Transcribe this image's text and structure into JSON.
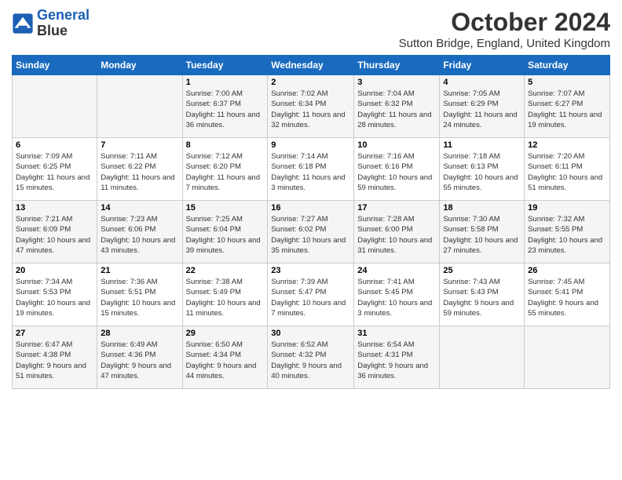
{
  "logo": {
    "line1": "General",
    "line2": "Blue"
  },
  "title": "October 2024",
  "location": "Sutton Bridge, England, United Kingdom",
  "headers": [
    "Sunday",
    "Monday",
    "Tuesday",
    "Wednesday",
    "Thursday",
    "Friday",
    "Saturday"
  ],
  "weeks": [
    [
      {
        "day": "",
        "sunrise": "",
        "sunset": "",
        "daylight": ""
      },
      {
        "day": "",
        "sunrise": "",
        "sunset": "",
        "daylight": ""
      },
      {
        "day": "1",
        "sunrise": "Sunrise: 7:00 AM",
        "sunset": "Sunset: 6:37 PM",
        "daylight": "Daylight: 11 hours and 36 minutes."
      },
      {
        "day": "2",
        "sunrise": "Sunrise: 7:02 AM",
        "sunset": "Sunset: 6:34 PM",
        "daylight": "Daylight: 11 hours and 32 minutes."
      },
      {
        "day": "3",
        "sunrise": "Sunrise: 7:04 AM",
        "sunset": "Sunset: 6:32 PM",
        "daylight": "Daylight: 11 hours and 28 minutes."
      },
      {
        "day": "4",
        "sunrise": "Sunrise: 7:05 AM",
        "sunset": "Sunset: 6:29 PM",
        "daylight": "Daylight: 11 hours and 24 minutes."
      },
      {
        "day": "5",
        "sunrise": "Sunrise: 7:07 AM",
        "sunset": "Sunset: 6:27 PM",
        "daylight": "Daylight: 11 hours and 19 minutes."
      }
    ],
    [
      {
        "day": "6",
        "sunrise": "Sunrise: 7:09 AM",
        "sunset": "Sunset: 6:25 PM",
        "daylight": "Daylight: 11 hours and 15 minutes."
      },
      {
        "day": "7",
        "sunrise": "Sunrise: 7:11 AM",
        "sunset": "Sunset: 6:22 PM",
        "daylight": "Daylight: 11 hours and 11 minutes."
      },
      {
        "day": "8",
        "sunrise": "Sunrise: 7:12 AM",
        "sunset": "Sunset: 6:20 PM",
        "daylight": "Daylight: 11 hours and 7 minutes."
      },
      {
        "day": "9",
        "sunrise": "Sunrise: 7:14 AM",
        "sunset": "Sunset: 6:18 PM",
        "daylight": "Daylight: 11 hours and 3 minutes."
      },
      {
        "day": "10",
        "sunrise": "Sunrise: 7:16 AM",
        "sunset": "Sunset: 6:16 PM",
        "daylight": "Daylight: 10 hours and 59 minutes."
      },
      {
        "day": "11",
        "sunrise": "Sunrise: 7:18 AM",
        "sunset": "Sunset: 6:13 PM",
        "daylight": "Daylight: 10 hours and 55 minutes."
      },
      {
        "day": "12",
        "sunrise": "Sunrise: 7:20 AM",
        "sunset": "Sunset: 6:11 PM",
        "daylight": "Daylight: 10 hours and 51 minutes."
      }
    ],
    [
      {
        "day": "13",
        "sunrise": "Sunrise: 7:21 AM",
        "sunset": "Sunset: 6:09 PM",
        "daylight": "Daylight: 10 hours and 47 minutes."
      },
      {
        "day": "14",
        "sunrise": "Sunrise: 7:23 AM",
        "sunset": "Sunset: 6:06 PM",
        "daylight": "Daylight: 10 hours and 43 minutes."
      },
      {
        "day": "15",
        "sunrise": "Sunrise: 7:25 AM",
        "sunset": "Sunset: 6:04 PM",
        "daylight": "Daylight: 10 hours and 39 minutes."
      },
      {
        "day": "16",
        "sunrise": "Sunrise: 7:27 AM",
        "sunset": "Sunset: 6:02 PM",
        "daylight": "Daylight: 10 hours and 35 minutes."
      },
      {
        "day": "17",
        "sunrise": "Sunrise: 7:28 AM",
        "sunset": "Sunset: 6:00 PM",
        "daylight": "Daylight: 10 hours and 31 minutes."
      },
      {
        "day": "18",
        "sunrise": "Sunrise: 7:30 AM",
        "sunset": "Sunset: 5:58 PM",
        "daylight": "Daylight: 10 hours and 27 minutes."
      },
      {
        "day": "19",
        "sunrise": "Sunrise: 7:32 AM",
        "sunset": "Sunset: 5:55 PM",
        "daylight": "Daylight: 10 hours and 23 minutes."
      }
    ],
    [
      {
        "day": "20",
        "sunrise": "Sunrise: 7:34 AM",
        "sunset": "Sunset: 5:53 PM",
        "daylight": "Daylight: 10 hours and 19 minutes."
      },
      {
        "day": "21",
        "sunrise": "Sunrise: 7:36 AM",
        "sunset": "Sunset: 5:51 PM",
        "daylight": "Daylight: 10 hours and 15 minutes."
      },
      {
        "day": "22",
        "sunrise": "Sunrise: 7:38 AM",
        "sunset": "Sunset: 5:49 PM",
        "daylight": "Daylight: 10 hours and 11 minutes."
      },
      {
        "day": "23",
        "sunrise": "Sunrise: 7:39 AM",
        "sunset": "Sunset: 5:47 PM",
        "daylight": "Daylight: 10 hours and 7 minutes."
      },
      {
        "day": "24",
        "sunrise": "Sunrise: 7:41 AM",
        "sunset": "Sunset: 5:45 PM",
        "daylight": "Daylight: 10 hours and 3 minutes."
      },
      {
        "day": "25",
        "sunrise": "Sunrise: 7:43 AM",
        "sunset": "Sunset: 5:43 PM",
        "daylight": "Daylight: 9 hours and 59 minutes."
      },
      {
        "day": "26",
        "sunrise": "Sunrise: 7:45 AM",
        "sunset": "Sunset: 5:41 PM",
        "daylight": "Daylight: 9 hours and 55 minutes."
      }
    ],
    [
      {
        "day": "27",
        "sunrise": "Sunrise: 6:47 AM",
        "sunset": "Sunset: 4:38 PM",
        "daylight": "Daylight: 9 hours and 51 minutes."
      },
      {
        "day": "28",
        "sunrise": "Sunrise: 6:49 AM",
        "sunset": "Sunset: 4:36 PM",
        "daylight": "Daylight: 9 hours and 47 minutes."
      },
      {
        "day": "29",
        "sunrise": "Sunrise: 6:50 AM",
        "sunset": "Sunset: 4:34 PM",
        "daylight": "Daylight: 9 hours and 44 minutes."
      },
      {
        "day": "30",
        "sunrise": "Sunrise: 6:52 AM",
        "sunset": "Sunset: 4:32 PM",
        "daylight": "Daylight: 9 hours and 40 minutes."
      },
      {
        "day": "31",
        "sunrise": "Sunrise: 6:54 AM",
        "sunset": "Sunset: 4:31 PM",
        "daylight": "Daylight: 9 hours and 36 minutes."
      },
      {
        "day": "",
        "sunrise": "",
        "sunset": "",
        "daylight": ""
      },
      {
        "day": "",
        "sunrise": "",
        "sunset": "",
        "daylight": ""
      }
    ]
  ]
}
